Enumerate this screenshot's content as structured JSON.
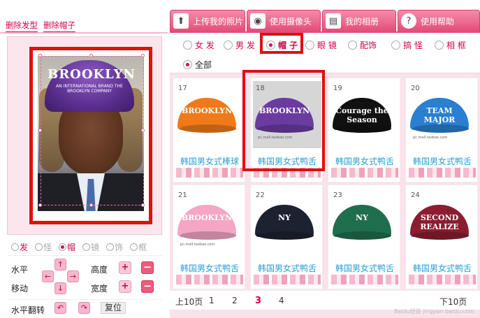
{
  "left": {
    "links": [
      "删除发型",
      "删除帽子"
    ],
    "photo_cap_text": "BROOKLYN",
    "photo_cap_sub": "AN INTERNATIONAL BRAND THE BROOKLYN COMPANY",
    "radios": [
      {
        "label": "发",
        "on": false
      },
      {
        "label": "怪",
        "on": false
      },
      {
        "label": "帽",
        "on": true
      },
      {
        "label": "镜",
        "on": false
      },
      {
        "label": "饰",
        "on": false
      },
      {
        "label": "框",
        "on": false
      }
    ],
    "controls": {
      "horizontal": "水平",
      "move": "移动",
      "height": "高度",
      "width": "宽度",
      "flip": "水平翻转",
      "reset": "复位",
      "plus": "+",
      "minus": "−",
      "up": "↑",
      "down": "↓",
      "left": "←",
      "right": "→",
      "flip_left": "↶",
      "flip_right": "↷"
    }
  },
  "tabs": [
    {
      "label": "上传我的照片",
      "icon": "upload-photo-icon"
    },
    {
      "label": "使用摄像头",
      "icon": "camera-icon"
    },
    {
      "label": "我的相册",
      "icon": "album-icon"
    },
    {
      "label": "使用帮助",
      "icon": "help-icon"
    }
  ],
  "filters": [
    {
      "label": "女 发",
      "on": false
    },
    {
      "label": "男 发",
      "on": false
    },
    {
      "label": "帽 子",
      "on": true
    },
    {
      "label": "眼 镜",
      "on": false
    },
    {
      "label": "配饰",
      "on": false
    },
    {
      "label": "搞 怪",
      "on": false
    },
    {
      "label": "相 框",
      "on": false
    }
  ],
  "subfilter": {
    "label": "全部",
    "on": true
  },
  "cards": [
    {
      "num": "17",
      "title": "韩国男女式棒球",
      "color": "#f07a1a",
      "word": "BROOKLYN",
      "wm": "",
      "selected": false
    },
    {
      "num": "18",
      "title": "韩国男女式鸭舌",
      "color": "#6a3ba0",
      "word": "BROOKLYN",
      "wm": "pc.mall.taobao.com",
      "selected": true
    },
    {
      "num": "19",
      "title": "韩国男女式鸭舌",
      "color": "#111111",
      "word": "Courage the Season",
      "wm": "",
      "selected": false
    },
    {
      "num": "20",
      "title": "韩国男女式鸭舌",
      "color": "#2a7fd0",
      "word": "TEAM MAJOR",
      "wm": "pc.mall.taobao.com",
      "selected": false
    },
    {
      "num": "21",
      "title": "韩国男女式鸭舌",
      "color": "#f4a6c4",
      "word": "BROOKLYN",
      "wm": "pc.mall.taobao.com",
      "selected": false
    },
    {
      "num": "22",
      "title": "韩国男女式鸭舌",
      "color": "#1c2230",
      "word": "NY",
      "wm": "",
      "selected": false
    },
    {
      "num": "23",
      "title": "韩国男女式鸭舌",
      "color": "#1f6e4e",
      "word": "NY",
      "wm": "",
      "selected": false
    },
    {
      "num": "24",
      "title": "韩国男女式鸭舌",
      "color": "#8a1e30",
      "word": "SECOND REALIZE",
      "wm": "",
      "selected": false
    }
  ],
  "pager": {
    "prev": "上10页",
    "pages": [
      "1",
      "2",
      "3",
      "4"
    ],
    "current": "3",
    "next": "下10页"
  },
  "watermark": "Baidu经验 jingyan.baidu.com",
  "colors": {
    "accent": "#e34d77",
    "highlight": "#e01010",
    "link": "#2a9fd6",
    "brand_pink": "#d4004c"
  }
}
